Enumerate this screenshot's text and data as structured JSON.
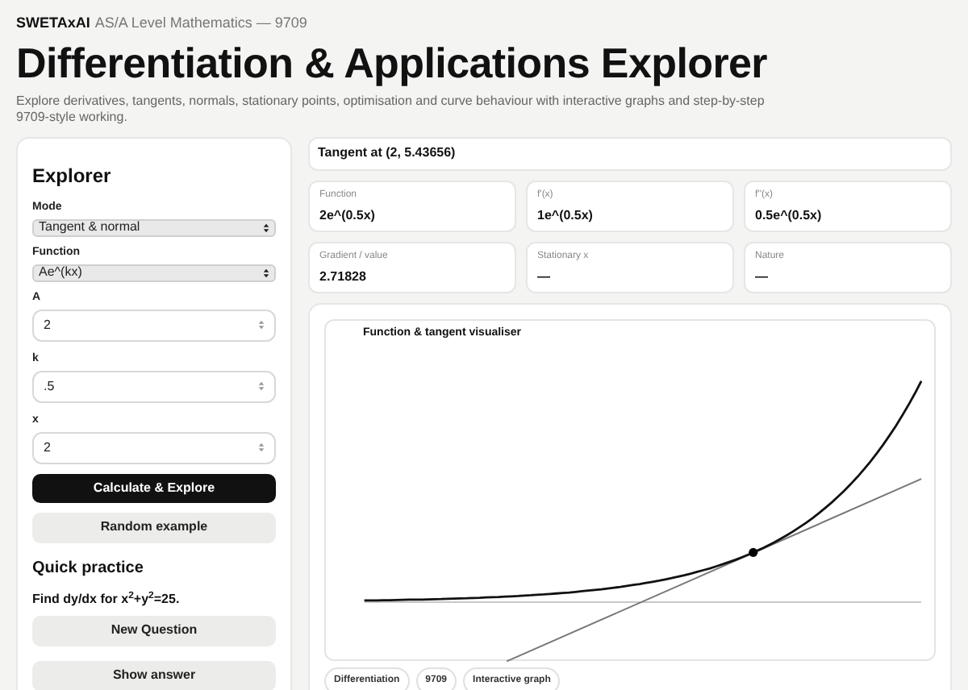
{
  "header": {
    "brand": "SWETAxAI",
    "subtitle": "AS/A Level Mathematics — 9709"
  },
  "title": "Differentiation & Applications Explorer",
  "description": "Explore derivatives, tangents, normals, stationary points, optimisation and curve behaviour with interactive graphs and step-by-step 9709-style working.",
  "explorer": {
    "title": "Explorer",
    "fields": [
      {
        "kind": "select",
        "label": "Mode",
        "value": "Tangent & normal"
      },
      {
        "kind": "select",
        "label": "Function",
        "value": "Ae^(kx)"
      },
      {
        "kind": "number",
        "label": "A",
        "value": "2"
      },
      {
        "kind": "number",
        "label": "k",
        "value": ".5"
      },
      {
        "kind": "number",
        "label": "x",
        "value": "2"
      }
    ],
    "buttons": [
      {
        "kind": "primary",
        "label": "Calculate & Explore"
      },
      {
        "kind": "secondary",
        "label": "Random example"
      }
    ]
  },
  "quick_practice": {
    "title": "Quick practice",
    "question": "Find dy/dx for x$^{2}$+y$^{2}$=25.",
    "buttons": [
      "New Question",
      "Show answer"
    ]
  },
  "result": {
    "title": "Tangent at (2, 5.43656)"
  },
  "stats": [
    {
      "label": "Function",
      "value": "2e^(0.5x)"
    },
    {
      "label": "f'(x)",
      "value": "1e^(0.5x)"
    },
    {
      "label": "f''(x)",
      "value": "0.5e^(0.5x)"
    },
    {
      "label": "Gradient / value",
      "value": "2.71828"
    },
    {
      "label": "Stationary x",
      "value": "—"
    },
    {
      "label": "Nature",
      "value": "—"
    }
  ],
  "graph": {
    "title": "Function & tangent visualiser"
  },
  "tags": [
    "Differentiation",
    "9709",
    "Interactive graph"
  ]
}
